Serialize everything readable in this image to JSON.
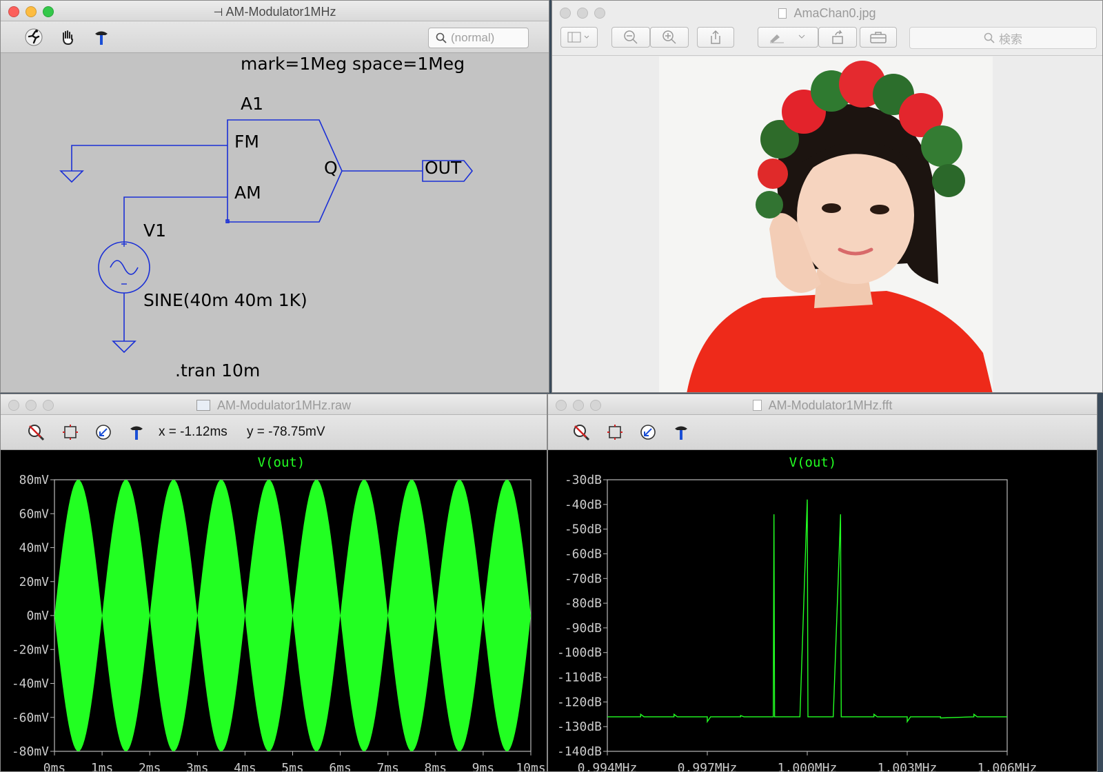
{
  "schematic_window": {
    "title": "AM-Modulator1MHz",
    "search_placeholder": "(normal)",
    "toolbar_icons": [
      "run-icon",
      "pan-hand-icon",
      "hammer-icon"
    ],
    "directive_top": "mark=1Meg space=1Meg",
    "component_name": "A1",
    "pin_fm": "FM",
    "pin_am": "AM",
    "pin_q": "Q",
    "net_label_out": "OUT",
    "source_name": "V1",
    "source_value": "SINE(40m 40m 1K)",
    "tran_directive": ".tran 10m",
    "wire_color": "#1a2fd6"
  },
  "preview_window": {
    "title": "AmaChan0.jpg",
    "search_placeholder": "検索",
    "toolbar_icons": [
      "sidebar-icon",
      "zoom-out-icon",
      "zoom-in-icon",
      "share-icon",
      "markup-icon",
      "rotate-icon",
      "toolbox-icon"
    ]
  },
  "waveform_window": {
    "title": "AM-Modulator1MHz.raw",
    "cursor_x": "x = -1.12ms",
    "cursor_y": "y = -78.75mV",
    "trace_label": "V(out)",
    "trace_color": "#22ff22"
  },
  "fft_window": {
    "title": "AM-Modulator1MHz.fft",
    "trace_label": "V(out)",
    "trace_color": "#22ff22"
  },
  "chart_data": [
    {
      "type": "area",
      "title": "V(out)",
      "x_ticks": [
        "0ms",
        "1ms",
        "2ms",
        "3ms",
        "4ms",
        "5ms",
        "6ms",
        "7ms",
        "8ms",
        "9ms",
        "10ms"
      ],
      "y_ticks": [
        "80mV",
        "60mV",
        "40mV",
        "20mV",
        "0mV",
        "-20mV",
        "-40mV",
        "-60mV",
        "-80mV"
      ],
      "xlim": [
        0,
        10
      ],
      "ylim": [
        -80,
        80
      ],
      "x_unit": "ms",
      "y_unit": "mV",
      "envelope": {
        "carrier": "1MHz",
        "modulation_frequency_khz": 1,
        "peak_mv": 80,
        "min_mv": 0
      },
      "series": [
        {
          "name": "V(out)",
          "color": "#22ff22"
        }
      ]
    },
    {
      "type": "line",
      "title": "V(out)",
      "x_ticks": [
        "0.994MHz",
        "0.997MHz",
        "1.000MHz",
        "1.003MHz",
        "1.006MHz"
      ],
      "y_ticks": [
        "-30dB",
        "-40dB",
        "-50dB",
        "-60dB",
        "-70dB",
        "-80dB",
        "-90dB",
        "-100dB",
        "-110dB",
        "-120dB",
        "-130dB",
        "-140dB"
      ],
      "xlim": [
        0.994,
        1.006
      ],
      "ylim": [
        -140,
        -30
      ],
      "x_unit": "MHz",
      "y_unit": "dB",
      "series": [
        {
          "name": "V(out)",
          "color": "#22ff22",
          "points": [
            [
              0.994,
              -126
            ],
            [
              0.995,
              -126
            ],
            [
              0.995,
              -125
            ],
            [
              0.9951,
              -126
            ],
            [
              0.996,
              -126
            ],
            [
              0.996,
              -125
            ],
            [
              0.9961,
              -126
            ],
            [
              0.997,
              -126
            ],
            [
              0.997,
              -128
            ],
            [
              0.9971,
              -126
            ],
            [
              0.998,
              -126
            ],
            [
              0.998,
              -125.5
            ],
            [
              0.9981,
              -126
            ],
            [
              0.99898,
              -126
            ],
            [
              0.999,
              -44
            ],
            [
              0.99902,
              -126
            ],
            [
              0.99978,
              -126
            ],
            [
              1.0,
              -38
            ],
            [
              1.00002,
              -126
            ],
            [
              1.00078,
              -126
            ],
            [
              1.001,
              -44
            ],
            [
              1.00102,
              -126
            ],
            [
              1.002,
              -126
            ],
            [
              1.002,
              -125
            ],
            [
              1.0021,
              -126
            ],
            [
              1.003,
              -126
            ],
            [
              1.003,
              -128
            ],
            [
              1.0031,
              -126
            ],
            [
              1.004,
              -126
            ],
            [
              1.004,
              -126.5
            ],
            [
              1.005,
              -126
            ],
            [
              1.005,
              -125
            ],
            [
              1.0051,
              -126
            ],
            [
              1.006,
              -126
            ]
          ]
        }
      ]
    }
  ]
}
